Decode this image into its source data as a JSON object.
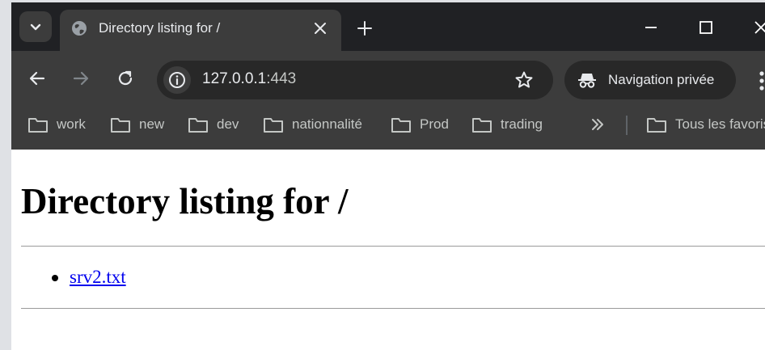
{
  "tab": {
    "title": "Directory listing for /",
    "favicon": "globe-icon"
  },
  "toolbar": {
    "url_host": "127.0.0.1",
    "url_port": ":443",
    "incognito_label": "Navigation privée"
  },
  "bookmarks": {
    "items": [
      {
        "label": "work",
        "icon": "folder-icon"
      },
      {
        "label": "new",
        "icon": "folder-icon"
      },
      {
        "label": "dev",
        "icon": "folder-icon"
      },
      {
        "label": "nationnalité",
        "icon": "folder-icon"
      },
      {
        "label": "Prod",
        "icon": "folder-icon"
      },
      {
        "label": "trading",
        "icon": "folder-icon"
      }
    ],
    "overflow_icon": "double-chevron-right-icon",
    "all_bookmarks_label": "Tous les favoris"
  },
  "page": {
    "heading": "Directory listing for /",
    "files": [
      "srv2.txt"
    ]
  },
  "colors": {
    "chrome_dark": "#202124",
    "toolbar": "#3c3c3c",
    "link": "#0000ee"
  }
}
